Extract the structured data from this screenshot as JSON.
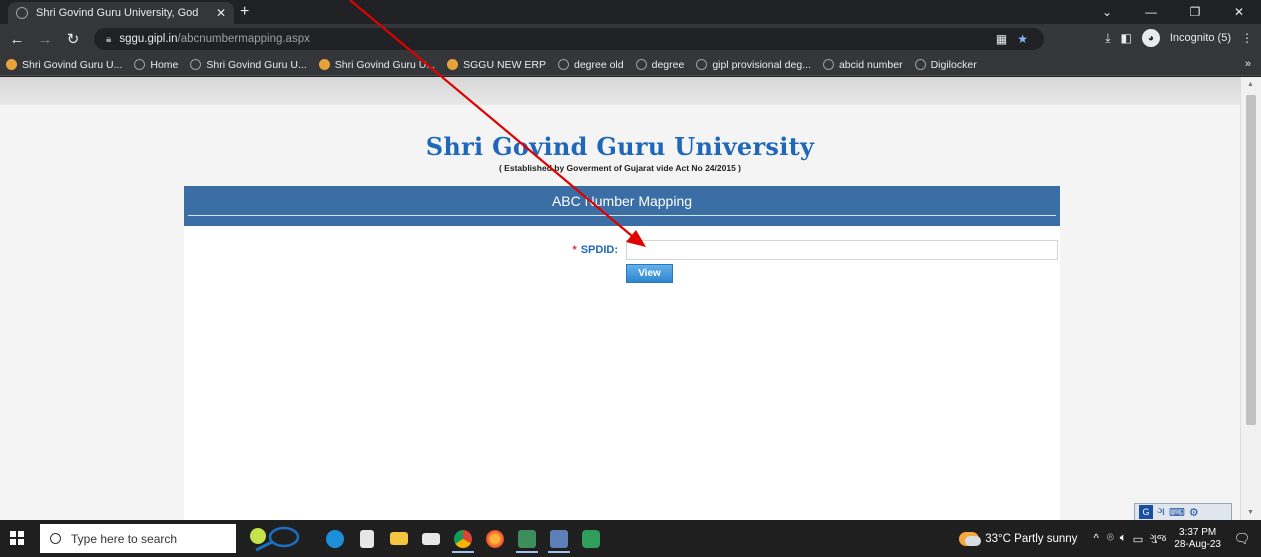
{
  "browser": {
    "tab_title": "Shri Govind Guru University, God",
    "url_host": "sggu.gipl.in",
    "url_path": "/abcnumbermapping.aspx",
    "incognito_label": "Incognito (5)",
    "bookmarks": [
      {
        "label": "Shri Govind Guru U...",
        "icon": "orange"
      },
      {
        "label": "Home",
        "icon": "globe"
      },
      {
        "label": "Shri Govind Guru U...",
        "icon": "globe"
      },
      {
        "label": "Shri Govind Guru U...",
        "icon": "orange"
      },
      {
        "label": "SGGU NEW ERP",
        "icon": "orange"
      },
      {
        "label": "degree old",
        "icon": "globe"
      },
      {
        "label": "degree",
        "icon": "globe"
      },
      {
        "label": "gipl provisional deg...",
        "icon": "globe"
      },
      {
        "label": "abcid number",
        "icon": "globe"
      },
      {
        "label": "Digilocker",
        "icon": "globe"
      }
    ]
  },
  "page": {
    "university_name": "Shri Govind Guru University",
    "subtitle": "( Established by Goverment of Gujarat vide Act No 24/2015 )",
    "panel_title": "ABC Number Mapping",
    "form": {
      "required_mark": "*",
      "spdid_label": "SPDID:",
      "spdid_value": "",
      "view_label": "View"
    }
  },
  "taskbar": {
    "search_placeholder": "Type here to search",
    "weather": "33°C  Partly sunny",
    "time": "3:37 PM",
    "date": "28-Aug-23",
    "lang": "ગુજ"
  },
  "colors": {
    "accent_blue": "#1f67b8",
    "panel_header": "#3a6ea5",
    "annotation_arrow": "#e00000"
  }
}
